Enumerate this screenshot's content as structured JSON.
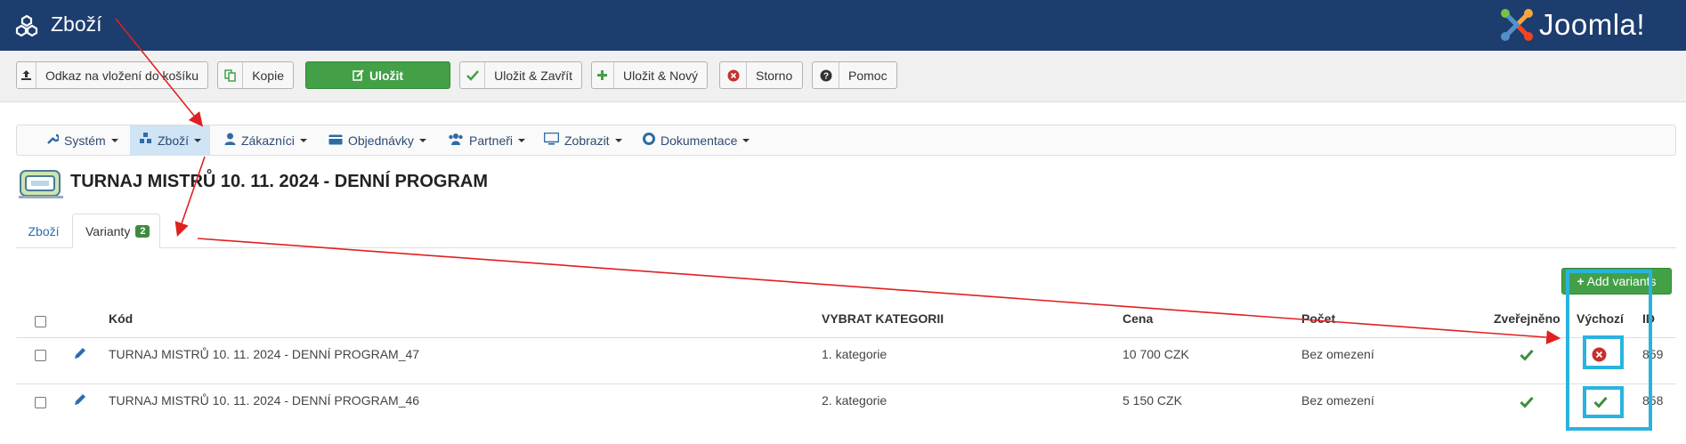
{
  "header": {
    "title": "Zboží",
    "logo_text": "Joomla!"
  },
  "toolbar": {
    "link_label": "Odkaz na vložení do košíku",
    "copy_label": "Kopie",
    "save_label": "Uložit",
    "save_close_label": "Uložit & Zavřít",
    "save_new_label": "Uložit & Nový",
    "cancel_label": "Storno",
    "help_label": "Pomoc"
  },
  "nav": {
    "items": [
      {
        "label": "Systém",
        "icon": "wrench-icon"
      },
      {
        "label": "Zboží",
        "icon": "cubes-icon"
      },
      {
        "label": "Zákazníci",
        "icon": "user-icon"
      },
      {
        "label": "Objednávky",
        "icon": "credit-card-icon"
      },
      {
        "label": "Partneři",
        "icon": "users-icon"
      },
      {
        "label": "Zobrazit",
        "icon": "monitor-icon"
      },
      {
        "label": "Dokumentace",
        "icon": "lifebuoy-icon"
      }
    ]
  },
  "page": {
    "title": "TURNAJ MISTRŮ 10. 11. 2024 - DENNÍ PROGRAM"
  },
  "tabs": {
    "products": "Zboží",
    "variants": "Varianty",
    "variants_count": "2"
  },
  "add_variants_label": "Add variants",
  "table": {
    "headers": {
      "code": "Kód",
      "category": "VYBRAT KATEGORII",
      "price": "Cena",
      "count": "Počet",
      "published": "Zveřejněno",
      "default": "Výchozí",
      "id": "ID"
    },
    "rows": [
      {
        "code": "TURNAJ MISTRŮ 10. 11. 2024 - DENNÍ PROGRAM_47",
        "category": "1. kategorie",
        "price": "10 700 CZK",
        "count": "Bez omezení",
        "published": true,
        "default": false,
        "id": "859"
      },
      {
        "code": "TURNAJ MISTRŮ 10. 11. 2024 - DENNÍ PROGRAM_46",
        "category": "2. kategorie",
        "price": "5 150 CZK",
        "count": "Bez omezení",
        "published": true,
        "default": true,
        "id": "858"
      }
    ]
  },
  "colors": {
    "header_bg": "#1c3d6e",
    "primary_green": "#43a047",
    "annotation_red": "#e02020",
    "annotation_cyan": "#2ab3de"
  }
}
